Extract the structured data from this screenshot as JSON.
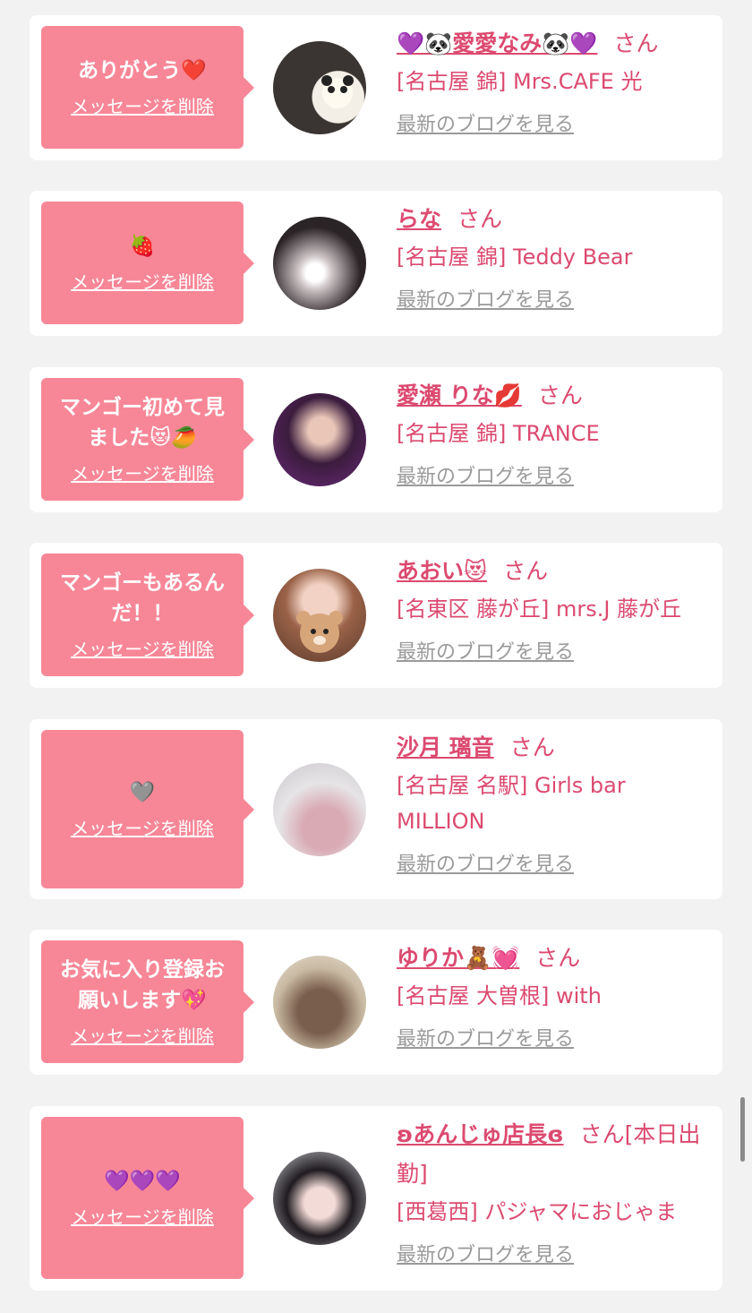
{
  "colors": {
    "accent": "#dc4a6f",
    "bubble": "#f78797",
    "link_gray": "#9a9a9a",
    "background": "#f2f2f2"
  },
  "items": [
    {
      "message": "ありがとう❤️",
      "delete_label": "メッセージを削除",
      "name": "💜🐼愛愛なみ🐼💜",
      "honorific": "さん",
      "shop": "[名古屋 錦] Mrs.CAFE 光",
      "blog_label": "最新のブログを見る",
      "avatar_icon": "avatar-photo"
    },
    {
      "message": "🍓",
      "delete_label": "メッセージを削除",
      "name": "らな",
      "honorific": "さん",
      "shop": "[名古屋 錦] Teddy Bear",
      "blog_label": "最新のブログを見る",
      "avatar_icon": "avatar-photo"
    },
    {
      "message": "マンゴー初めて見ました😻🥭",
      "delete_label": "メッセージを削除",
      "name": "愛瀬 りな💋",
      "honorific": "さん",
      "shop": "[名古屋 錦] TRANCE",
      "blog_label": "最新のブログを見る",
      "avatar_icon": "avatar-photo"
    },
    {
      "message": "マンゴーもあるんだ！！",
      "delete_label": "メッセージを削除",
      "name": "あおい😻",
      "honorific": "さん",
      "shop": "[名東区 藤が丘] mrs.J 藤が丘",
      "blog_label": "最新のブログを見る",
      "avatar_icon": "avatar-photo"
    },
    {
      "message": "🩶",
      "delete_label": "メッセージを削除",
      "name": "沙月 璃音",
      "honorific": "さん",
      "shop": "[名古屋 名駅] Girls bar MILLION",
      "blog_label": "最新のブログを見る",
      "avatar_icon": "avatar-photo"
    },
    {
      "message": "お気に入り登録お願いします💖",
      "delete_label": "メッセージを削除",
      "name": "ゆりか🧸💓",
      "honorific": "さん",
      "shop": "[名古屋 大曽根] with",
      "blog_label": "最新のブログを見る",
      "avatar_icon": "avatar-photo"
    },
    {
      "message": "💜💜💜",
      "delete_label": "メッセージを削除",
      "name": "ʚあんじゅ店長ɞ",
      "honorific": "さん[本日出勤]",
      "shop": "[西葛西] パジャマにおじゃま",
      "blog_label": "最新のブログを見る",
      "avatar_icon": "avatar-photo"
    }
  ]
}
